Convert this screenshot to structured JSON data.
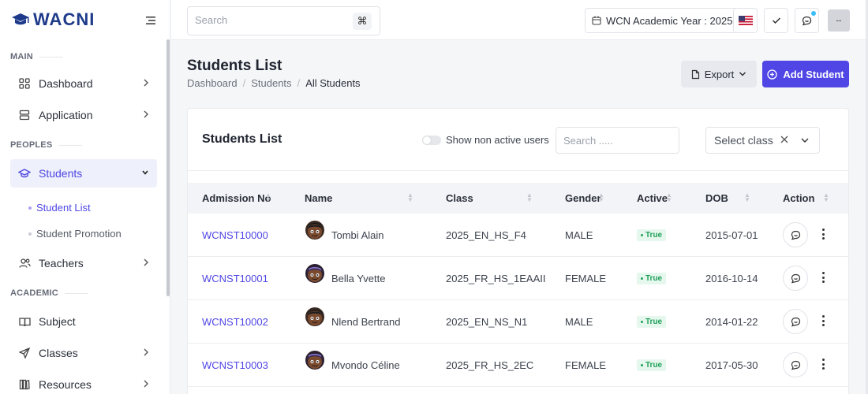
{
  "brand": {
    "name": "WACNI",
    "color": "#1e3a8a"
  },
  "accent": "#4f46e5",
  "sidebar": {
    "sections": [
      "MAIN",
      "PEOPLES",
      "ACADEMIC"
    ],
    "items": [
      {
        "label": "Dashboard",
        "icon": "dashboard-grid-icon"
      },
      {
        "label": "Application",
        "icon": "server-stack-icon"
      },
      {
        "label": "Students",
        "icon": "graduation-cap-icon"
      },
      {
        "label": "Teachers",
        "icon": "users-icon"
      },
      {
        "label": "Subject",
        "icon": "book-open-icon"
      },
      {
        "label": "Classes",
        "icon": "send-icon"
      },
      {
        "label": "Resources",
        "icon": "library-icon"
      }
    ],
    "sub_items": [
      {
        "label": "Student List"
      },
      {
        "label": "Student Promotion"
      }
    ]
  },
  "topbar": {
    "search_placeholder": "Search",
    "cmd_key": "⌘",
    "academic_year": "WCN Academic Year : 2025",
    "avatar_text": "--"
  },
  "page": {
    "title": "Students List",
    "breadcrumb": [
      "Dashboard",
      "Students",
      "All Students"
    ],
    "export_label": "Export",
    "add_label": "Add Student"
  },
  "card": {
    "title": "Students List",
    "toggle_label": "Show non active users",
    "search_placeholder": "Search .....",
    "select_placeholder": "Select class"
  },
  "table": {
    "headers": [
      "Admission No",
      "Name",
      "Class",
      "Gender",
      "Active",
      "DOB",
      "Action"
    ],
    "rows": [
      {
        "admission": "WCNST10000",
        "name": "Tombi Alain",
        "class": "2025_EN_HS_F4",
        "gender": "MALE",
        "active": "True",
        "dob": "2015-07-01",
        "avatar": "male"
      },
      {
        "admission": "WCNST10001",
        "name": "Bella Yvette",
        "class": "2025_FR_HS_1EAAII",
        "gender": "FEMALE",
        "active": "True",
        "dob": "2016-10-14",
        "avatar": "female"
      },
      {
        "admission": "WCNST10002",
        "name": "Nlend Bertrand",
        "class": "2025_EN_NS_N1",
        "gender": "MALE",
        "active": "True",
        "dob": "2014-01-22",
        "avatar": "male"
      },
      {
        "admission": "WCNST10003",
        "name": "Mvondo Céline",
        "class": "2025_FR_HS_2EC",
        "gender": "FEMALE",
        "active": "True",
        "dob": "2017-05-30",
        "avatar": "female"
      }
    ]
  }
}
